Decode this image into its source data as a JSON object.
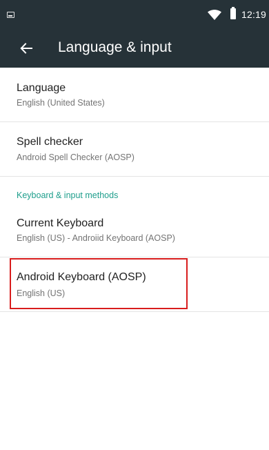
{
  "status_bar": {
    "time": "12:19",
    "icons": [
      "notification-icon",
      "wifi-icon",
      "battery-icon"
    ],
    "color": "#263238"
  },
  "toolbar": {
    "title": "Language & input",
    "back_icon": "arrow-back-icon",
    "color": "#263238"
  },
  "preferences": {
    "language": {
      "title": "Language",
      "summary": "English (United States)"
    },
    "spell_checker": {
      "title": "Spell checker",
      "summary": "Android Spell Checker (AOSP)"
    },
    "category_keyboard": {
      "label": "Keyboard & input methods",
      "color": "#1e9e8c"
    },
    "current_keyboard": {
      "title": "Current Keyboard",
      "summary": "English (US) - Androiid Keyboard (AOSP)"
    },
    "android_keyboard": {
      "title": "Android Keyboard (AOSP)",
      "summary": "English (US)",
      "highlighted": true,
      "highlight_color": "#d81c1c"
    }
  }
}
